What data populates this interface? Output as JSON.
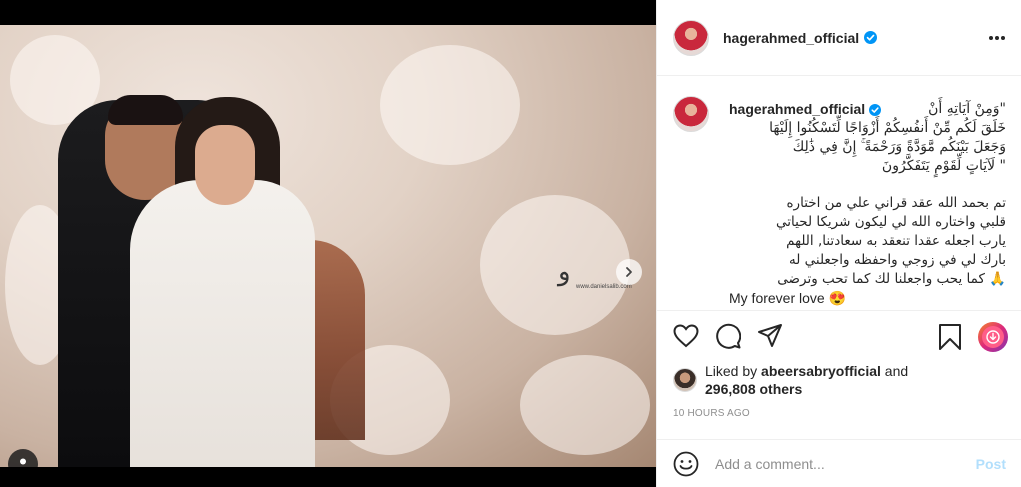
{
  "post": {
    "username": "hagerahmed_official",
    "verified": true
  },
  "caption": {
    "username": "hagerahmed_official",
    "verse_lines": [
      "\"وَمِنْ آيَاتِهِ أَنْ",
      "خَلَقَ لَكُم مِّنْ أَنفُسِكُمْ أَزْوَاجًا لِّتَسْكُنُوا إِلَيْهَا",
      "وَجَعَلَ بَيْنَكُم مَّوَدَّةً وَرَحْمَةً ۚ إِنَّ فِي ذَٰلِكَ",
      "\" لَآيَاتٍ لِّقَوْمٍ يَتَفَكَّرُونَ"
    ],
    "message_lines": [
      "تم بحمد الله عقد قراني علي من اختاره",
      "قلبي واختاره الله لي ليكون شريكا لحياتي",
      "يارب اجعله عقدا تنعقد به سعادتنا, اللهم",
      "بارك لي في زوجي واحفظه واجعلني له",
      "🙏 كما يحب واجعلنا لك كما تحب وترضى",
      "My forever love 😍"
    ]
  },
  "photo": {
    "watermark_mark": "و",
    "watermark_url": "www.danielsalib.com"
  },
  "likes": {
    "prefix": "Liked by",
    "liker": "abeersabryofficial",
    "conjunction": "and",
    "others": "296,808 others"
  },
  "timestamp": "10 HOURS AGO",
  "comment": {
    "placeholder": "Add a comment...",
    "post_label": "Post"
  },
  "colors": {
    "verified_blue": "#0095f6",
    "post_disabled": "#b2dffc",
    "muted_text": "#8e8e8e"
  },
  "icons": [
    "more-options-icon",
    "heart-icon",
    "comment-icon",
    "share-icon",
    "bookmark-icon",
    "download-icon",
    "emoji-icon",
    "user-tag-icon",
    "chevron-right-icon",
    "verified-icon"
  ]
}
